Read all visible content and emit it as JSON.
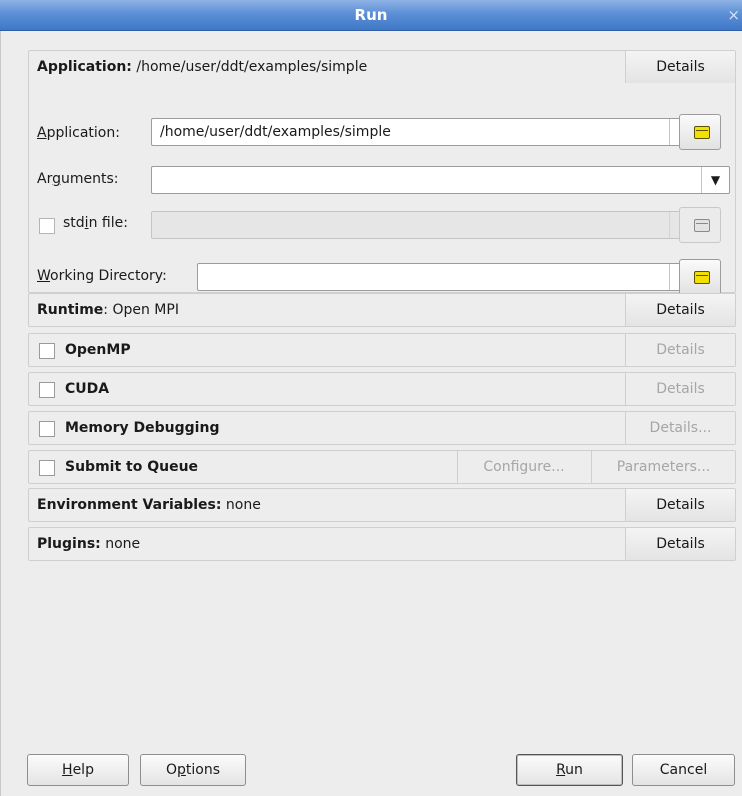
{
  "window": {
    "title": "Run",
    "close_glyph": "×"
  },
  "application_group": {
    "header_label": "Application:",
    "header_value": "/home/user/ddt/examples/simple",
    "details_label": "Details",
    "application": {
      "label_pre": "",
      "label_mnemonic": "A",
      "label_post": "pplication:",
      "value": "/home/user/ddt/examples/simple"
    },
    "arguments": {
      "label_pre": "Ar",
      "label_mnemonic": "g",
      "label_post": "uments:",
      "value": ""
    },
    "stdin": {
      "label_pre": "std",
      "label_mnemonic": "i",
      "label_post": "n file:",
      "value": "",
      "checked": false,
      "enabled": false
    },
    "working_directory": {
      "label_pre": "",
      "label_mnemonic": "W",
      "label_post": "orking Directory:",
      "value": ""
    }
  },
  "runtime": {
    "label": "Runtime",
    "value": ": Open MPI",
    "details_label": "Details"
  },
  "openmp": {
    "label": "OpenMP",
    "checked": false,
    "details_label": "Details"
  },
  "cuda": {
    "label": "CUDA",
    "checked": false,
    "details_label": "Details"
  },
  "memory_debugging": {
    "label": "Memory Debugging",
    "checked": false,
    "details_label": "Details..."
  },
  "submit_to_queue": {
    "label": "Submit to Queue",
    "checked": false,
    "configure_label": "Configure...",
    "parameters_label": "Parameters..."
  },
  "environment_variables": {
    "label": "Environment Variables:",
    "value": " none",
    "details_label": "Details"
  },
  "plugins": {
    "label": "Plugins:",
    "value": " none",
    "details_label": "Details"
  },
  "buttons": {
    "help": {
      "mnemonic": "H",
      "rest": "elp"
    },
    "options": {
      "pre": "O",
      "mnemonic": "p",
      "rest": "tions"
    },
    "run": {
      "mnemonic": "R",
      "rest": "un"
    },
    "cancel": {
      "label": "Cancel"
    }
  },
  "icons": {
    "combo_arrow": "chevron-down-icon",
    "folder": "folder-icon"
  },
  "colors": {
    "title_bar": "#5c8fd6",
    "folder_icon": "#f2e000",
    "disabled_text": "#a6a6a6"
  }
}
